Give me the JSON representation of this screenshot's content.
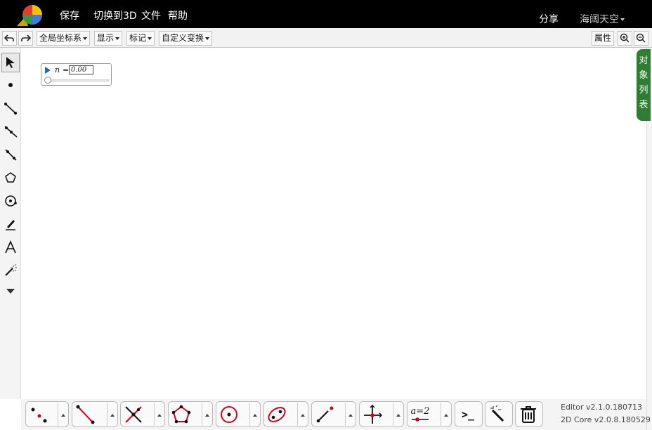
{
  "header": {
    "menu": [
      "保存",
      "切换到3D",
      "文件",
      "帮助"
    ],
    "share": "分享",
    "user": "海阔天空"
  },
  "toolbar": {
    "coord": "全局坐标系",
    "display": "显示",
    "mark": "标记",
    "transform": "自定义变换",
    "properties": "属性"
  },
  "side_tab": {
    "text": "对象列表"
  },
  "slider": {
    "name": "n",
    "equals": "=",
    "value": "0.00",
    "fraction": 0.0
  },
  "left_tools": [
    "select-arrow-icon",
    "point-icon",
    "segment-icon",
    "ray-icon",
    "line-icon",
    "polygon-icon",
    "circle-icon",
    "pen-icon",
    "text-icon",
    "magic-wand-icon",
    "more-down-icon"
  ],
  "bottom_tools": [
    "point-group",
    "segment-group",
    "intersect-group",
    "polygon-group",
    "circle-group",
    "conic-group",
    "vector-group",
    "axes-group",
    "measure-group",
    "command-button",
    "magic-button",
    "delete-button"
  ],
  "bottom": {
    "measure_label": "a=2",
    "command_label": ">_"
  },
  "versions": {
    "editor": "Editor v2.1.0.180713",
    "core": "2D Core v2.0.8.180529"
  },
  "colors": {
    "accent_green": "#2e7d32",
    "play_blue": "#1e63c6",
    "topbar": "#000000",
    "tool_red": "#d0021b"
  }
}
